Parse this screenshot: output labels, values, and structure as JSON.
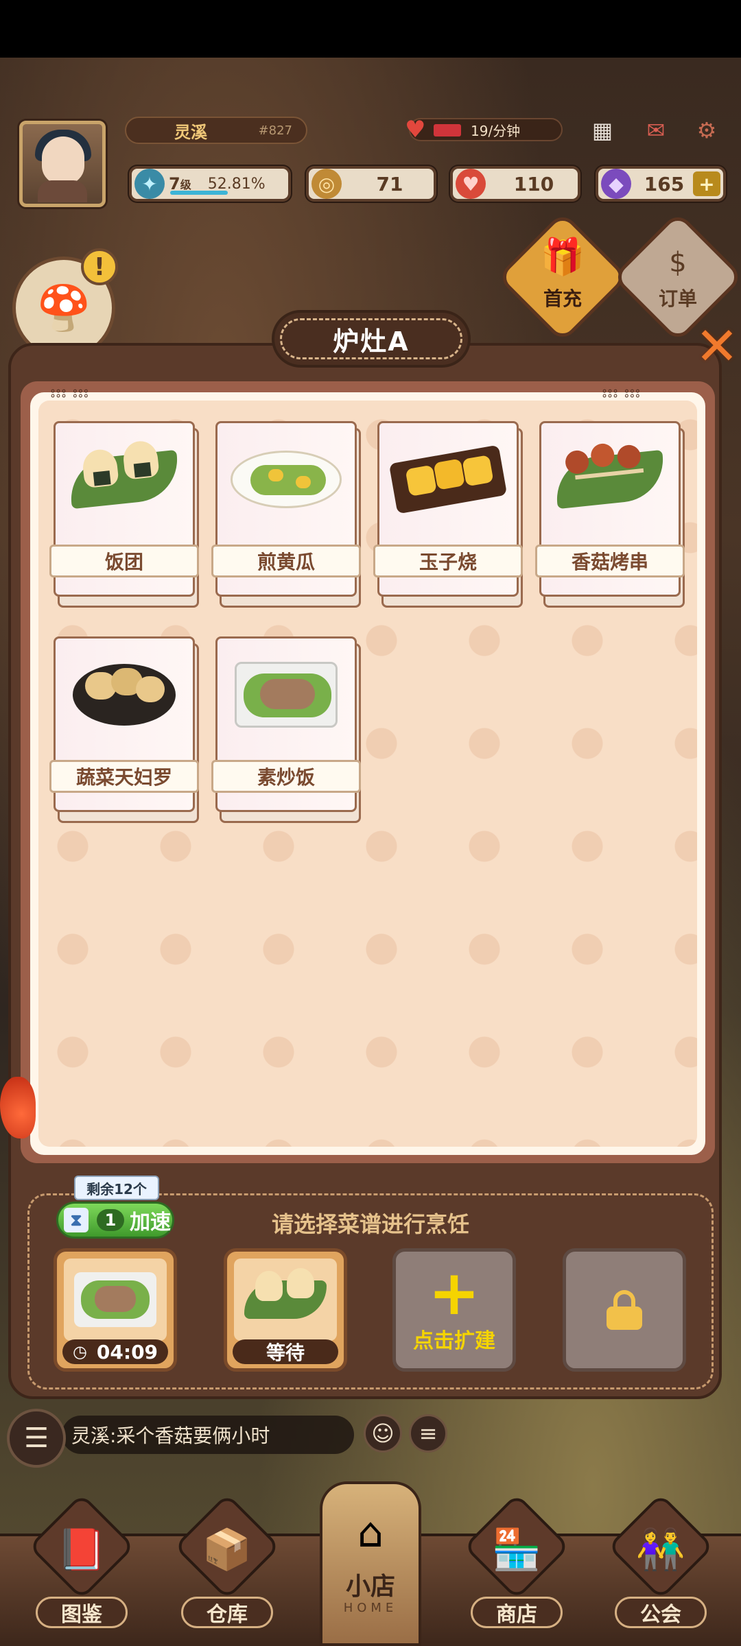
{
  "player": {
    "name": "灵溪",
    "id": "#827",
    "level_label": "级",
    "level": "7",
    "exp_percent": "52.81%",
    "rate": "19/分钟"
  },
  "resources": {
    "coins": "71",
    "hearts": "110",
    "gems": "165",
    "add_symbol": "+"
  },
  "top_buttons": {
    "first_charge": "首充",
    "orders": "订单"
  },
  "alert_symbol": "!",
  "panel": {
    "title": "炉灶A",
    "recipes": [
      {
        "name": "饭团"
      },
      {
        "name": "煎黄瓜"
      },
      {
        "name": "玉子烧"
      },
      {
        "name": "香菇烤串"
      },
      {
        "name": "蔬菜天妇罗"
      },
      {
        "name": "素炒饭"
      }
    ]
  },
  "queue": {
    "hint": "请选择菜谱进行烹饪",
    "remaining": "剩余12个",
    "speed_count": "1",
    "speed_label": "加速",
    "slots": [
      {
        "state": "cooking",
        "timer": "04:09"
      },
      {
        "state": "waiting",
        "label": "等待"
      },
      {
        "state": "expand",
        "label": "点击扩建",
        "symbol": "+"
      },
      {
        "state": "locked"
      }
    ]
  },
  "chat": {
    "message": "灵溪:采个香菇要俩小时"
  },
  "nav": {
    "items": [
      {
        "label": "图鉴"
      },
      {
        "label": "仓库"
      },
      {
        "label": "商店"
      },
      {
        "label": "公会"
      }
    ],
    "home_label": "小店",
    "home_sub": "HOME"
  },
  "colors": {
    "accent_orange": "#f07a2d",
    "panel_brown": "#5b3a2a",
    "card_bg": "#f8dec6",
    "speed_green": "#3f9a2c",
    "expand_yellow": "#f5d400"
  }
}
